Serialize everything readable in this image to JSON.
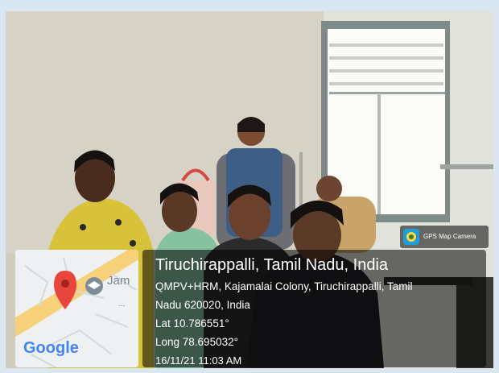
{
  "badge": {
    "label": "GPS Map Camera",
    "icon": "gps-map-camera-icon"
  },
  "location": {
    "title": "Tiruchirappalli, Tamil Nadu, India",
    "address_line1": "QMPV+HRM, Kajamalai Colony, Tiruchirappalli, Tamil",
    "address_line2": "Nadu 620020, India",
    "lat": "Lat 10.786551°",
    "long": "Long 78.695032°",
    "datetime": "16/11/21 11:03 AM"
  },
  "map": {
    "label": "Jam",
    "logo": "Google",
    "more": "..."
  },
  "colors": {
    "pin": "#e8453c",
    "road": "#f7d07a",
    "map_bg": "#eef0f1",
    "accent": "#1f9ed8"
  }
}
